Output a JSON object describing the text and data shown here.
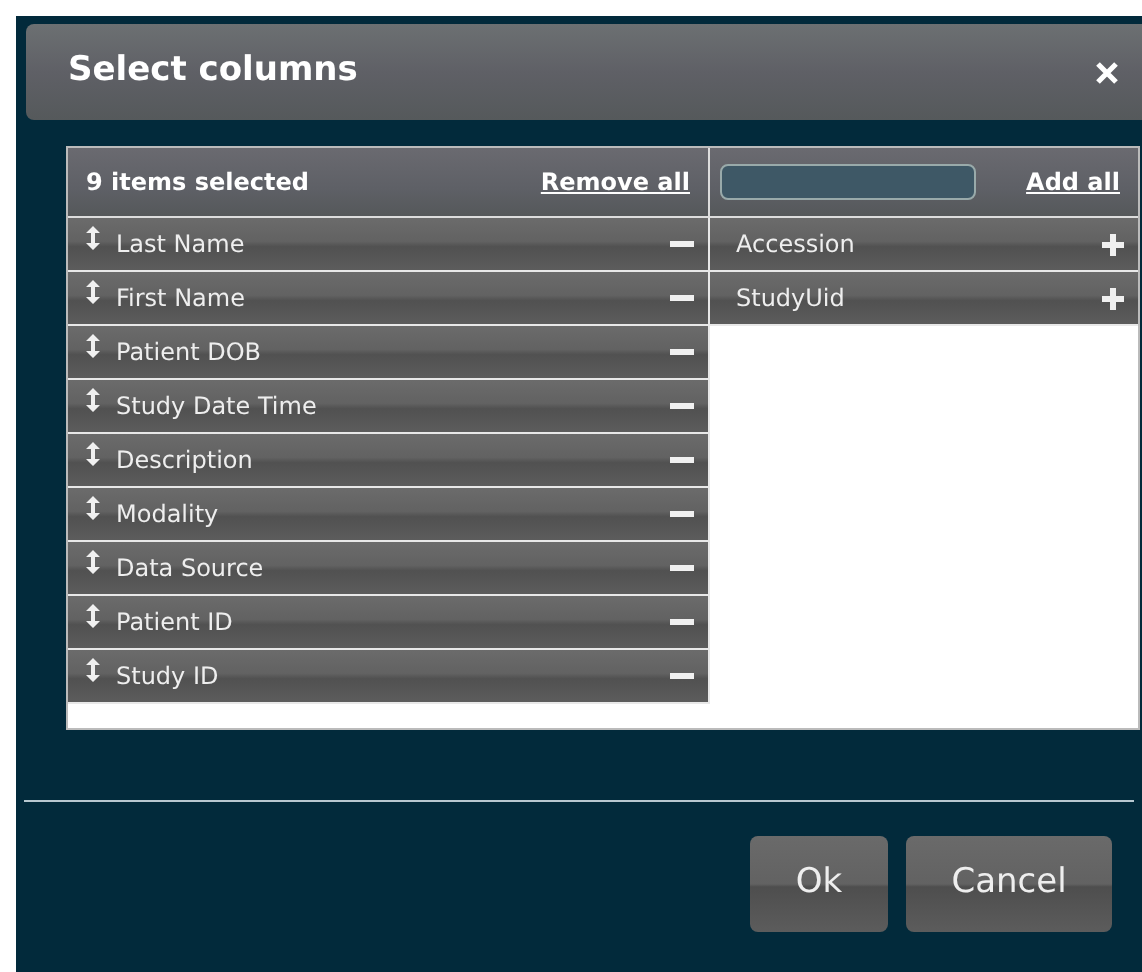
{
  "dialog": {
    "title": "Select columns"
  },
  "selected_panel": {
    "count_label": "9 items selected",
    "remove_all": "Remove all",
    "items": [
      {
        "label": "Last Name"
      },
      {
        "label": "First Name"
      },
      {
        "label": "Patient DOB"
      },
      {
        "label": "Study Date Time"
      },
      {
        "label": "Description"
      },
      {
        "label": "Modality"
      },
      {
        "label": "Data Source"
      },
      {
        "label": "Patient ID"
      },
      {
        "label": "Study ID"
      }
    ]
  },
  "available_panel": {
    "add_all": "Add all",
    "items": [
      {
        "label": "Accession"
      },
      {
        "label": "StudyUid"
      }
    ]
  },
  "buttons": [
    "Ok",
    "Cancel"
  ]
}
